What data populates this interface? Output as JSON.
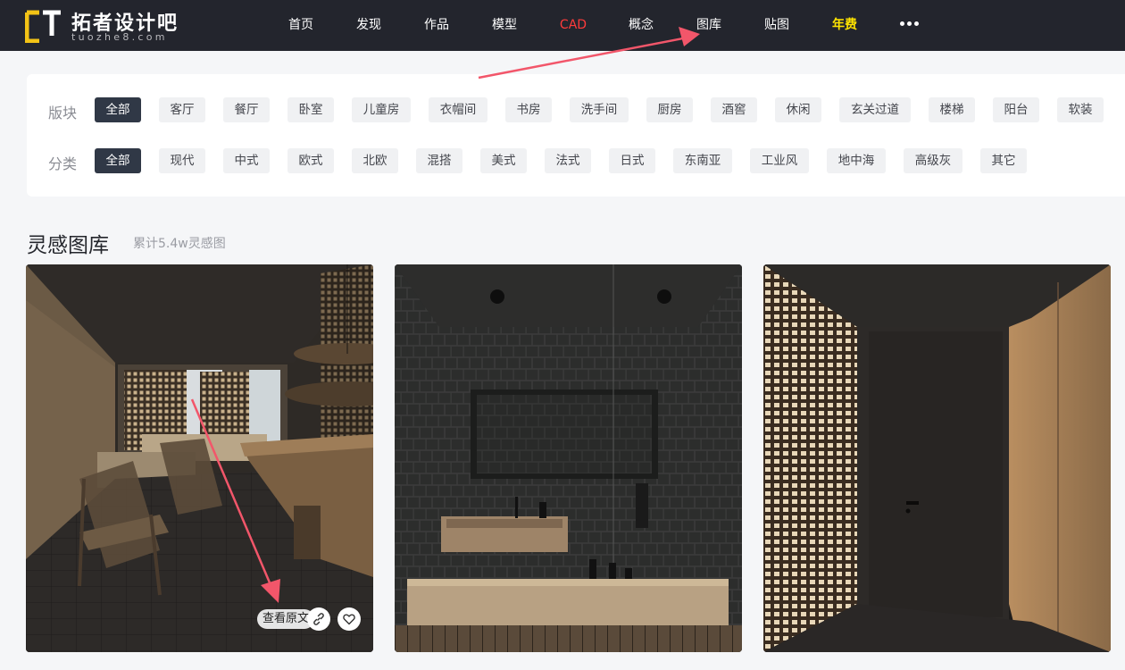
{
  "brand": {
    "name": "拓者设计吧",
    "domain": "tuozhe8.com",
    "colors": {
      "mark": "#f3c316"
    }
  },
  "nav": {
    "items": [
      {
        "label": "首页",
        "key": "home"
      },
      {
        "label": "发现",
        "key": "discover"
      },
      {
        "label": "作品",
        "key": "works"
      },
      {
        "label": "模型",
        "key": "models"
      },
      {
        "label": "CAD",
        "key": "cad",
        "color": "#ff3b3b"
      },
      {
        "label": "概念",
        "key": "concept"
      },
      {
        "label": "图库",
        "key": "gallery"
      },
      {
        "label": "贴图",
        "key": "textures"
      },
      {
        "label": "年费",
        "key": "annual",
        "color": "#ffe400"
      }
    ],
    "more_icon": "more-dots-icon"
  },
  "filters": {
    "block": {
      "label": "版块",
      "options": [
        "全部",
        "客厅",
        "餐厅",
        "卧室",
        "儿童房",
        "衣帽间",
        "书房",
        "洗手间",
        "厨房",
        "酒窖",
        "休闲",
        "玄关过道",
        "楼梯",
        "阳台",
        "软装"
      ],
      "selected": "全部"
    },
    "category": {
      "label": "分类",
      "options": [
        "全部",
        "现代",
        "中式",
        "欧式",
        "北欧",
        "混搭",
        "美式",
        "法式",
        "日式",
        "东南亚",
        "工业风",
        "地中海",
        "高级灰",
        "其它"
      ],
      "selected": "全部"
    }
  },
  "gallery": {
    "title": "灵感图库",
    "subtitle": "累计5.4w灵感图",
    "cards": [
      {
        "scene": "dark-living-room-with-wooden-screens",
        "action_label": "查看原文",
        "link_icon": "link-icon",
        "like_icon": "heart-icon"
      },
      {
        "scene": "dark-tiled-bathroom-with-wood-vanity"
      },
      {
        "scene": "corridor-with-wooden-lattice-and-dark-door"
      }
    ]
  },
  "annotations": {
    "arrow_color": "#f2566a"
  }
}
